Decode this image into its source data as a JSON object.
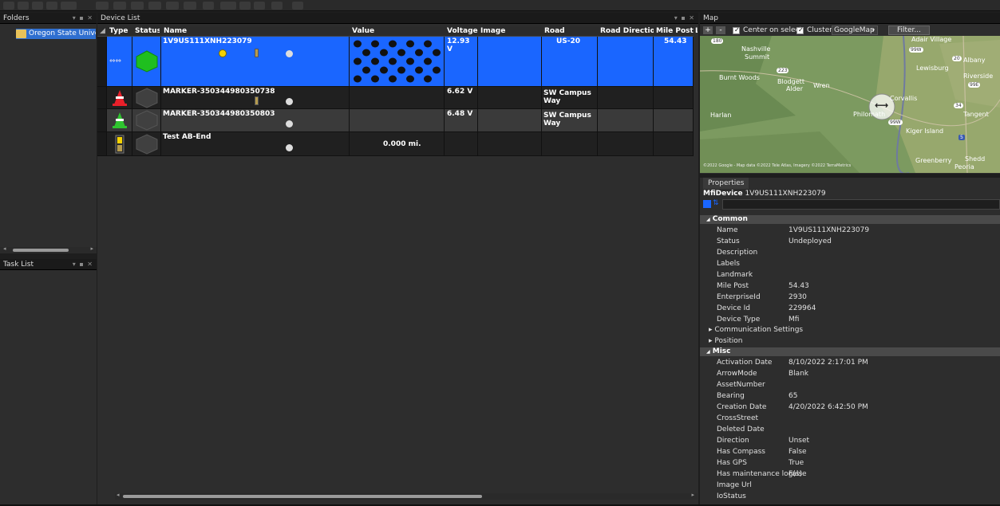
{
  "panels": {
    "folders_title": "Folders",
    "device_list_title": "Device List",
    "map_title": "Map",
    "task_list_title": "Task List",
    "properties_title": "Properties"
  },
  "folders": {
    "items": [
      {
        "label": "Oregon State Univers"
      }
    ]
  },
  "grid": {
    "columns": [
      "Type",
      "Status",
      "Name",
      "Value",
      "Voltage",
      "Image",
      "Road",
      "Road Direction ▲",
      "Mile Post",
      "L"
    ],
    "rows": [
      {
        "name": "1V9US111XNH223079",
        "value": "",
        "voltage": "12.93 V",
        "image": "",
        "road": "US-20",
        "road_direction": "",
        "mile_post": "54.43",
        "type_icon": "arrow-board-icon",
        "status_color": "#1fbf1f"
      },
      {
        "name": "MARKER-350344980350738",
        "value": "",
        "voltage": "6.62 V",
        "image": "",
        "road": "SW Campus Way",
        "road_direction": "",
        "mile_post": "",
        "type_icon": "red-cone-icon",
        "status_color": "#404040"
      },
      {
        "name": "MARKER-350344980350803",
        "value": "",
        "voltage": "6.48 V",
        "image": "",
        "road": "SW Campus Way",
        "road_direction": "",
        "mile_post": "",
        "type_icon": "green-cone-icon",
        "status_color": "#404040"
      },
      {
        "name": "Test AB-End",
        "value": "0.000 mi.",
        "voltage": "",
        "image": "",
        "road": "",
        "road_direction": "",
        "mile_post": "",
        "type_icon": "battery-icon",
        "status_color": "#404040"
      }
    ]
  },
  "map": {
    "zoom_in": "+",
    "zoom_out": "-",
    "center_label": "Center on select",
    "cluster_label": "Cluster",
    "provider": "GoogleMap",
    "filter_label": "Filter...",
    "places": [
      "Adair Village",
      "Nashville",
      "Summit",
      "Albany",
      "Lewisburg",
      "Burnt Woods",
      "Blodgett",
      "Wren",
      "Alder",
      "Riverside",
      "Corvallis",
      "Harlan",
      "Philomath",
      "Tangent",
      "Kiger Island",
      "Shedd",
      "Greenberry",
      "Peoria"
    ],
    "road_shields": [
      "180",
      "99W",
      "20",
      "223",
      "34",
      "99E",
      "99W",
      "5"
    ],
    "attribution": "©2022 Google - Map data ©2022 Tele Atlas, Imagery ©2022 TerraMetrics"
  },
  "properties": {
    "object_type": "MfiDevice",
    "object_name": "1V9US111XNH223079",
    "common_label": "Common",
    "common": [
      {
        "k": "Name",
        "v": "1V9US111XNH223079"
      },
      {
        "k": "Status",
        "v": "Undeployed"
      },
      {
        "k": "Description",
        "v": ""
      },
      {
        "k": "Labels",
        "v": ""
      },
      {
        "k": "Landmark",
        "v": ""
      },
      {
        "k": "Mile Post",
        "v": "54.43"
      },
      {
        "k": "EnterpriseId",
        "v": "2930"
      },
      {
        "k": "Device Id",
        "v": "229964"
      },
      {
        "k": "Device Type",
        "v": "Mfi"
      }
    ],
    "expanders": [
      "Communication Settings",
      "Position"
    ],
    "misc_label": "Misc",
    "misc": [
      {
        "k": "Activation Date",
        "v": "8/10/2022 2:17:01 PM"
      },
      {
        "k": "ArrowMode",
        "v": "Blank"
      },
      {
        "k": "AssetNumber",
        "v": ""
      },
      {
        "k": "Bearing",
        "v": "65"
      },
      {
        "k": "Creation Date",
        "v": "4/20/2022 6:42:50 PM"
      },
      {
        "k": "CrossStreet",
        "v": ""
      },
      {
        "k": "Deleted Date",
        "v": ""
      },
      {
        "k": "Direction",
        "v": "Unset"
      },
      {
        "k": "Has Compass",
        "v": "False"
      },
      {
        "k": "Has GPS",
        "v": "True"
      },
      {
        "k": "Has maintenance log(s)",
        "v": "False"
      },
      {
        "k": "Image Url",
        "v": ""
      },
      {
        "k": "IoStatus",
        "v": ""
      }
    ]
  },
  "colors": {
    "selection": "#1a66ff",
    "folder_selection": "#2f6fd0"
  }
}
